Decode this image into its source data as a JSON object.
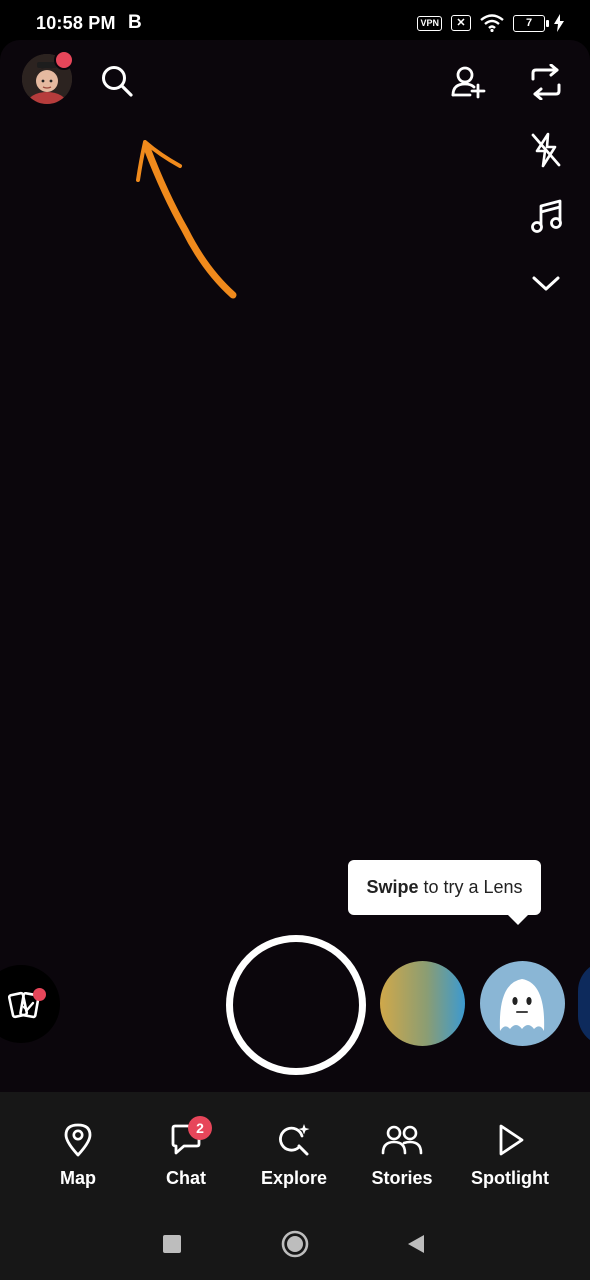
{
  "status_bar": {
    "time": "10:58 PM",
    "app_indicator": "B",
    "vpn_label": "VPN",
    "battery_level": "7"
  },
  "camera": {
    "top_icons": [
      "avatar",
      "search-icon",
      "add-friend-icon",
      "flip-camera-icon",
      "flash-off-icon",
      "music-note-icon",
      "chevron-down-icon"
    ],
    "annotation": "orange-arrow",
    "annotation_color": "#f08a1c"
  },
  "tooltip": {
    "bold": "Swipe",
    "rest": "to try a Lens"
  },
  "nav": {
    "items": [
      {
        "label": "Map",
        "icon": "map-pin-icon"
      },
      {
        "label": "Chat",
        "icon": "chat-icon",
        "badge": "2"
      },
      {
        "label": "Explore",
        "icon": "explore-icon"
      },
      {
        "label": "Stories",
        "icon": "stories-icon"
      },
      {
        "label": "Spotlight",
        "icon": "spotlight-icon"
      }
    ]
  },
  "system_nav": [
    "recents-button",
    "home-button",
    "back-button"
  ],
  "colors": {
    "accent_badge": "#e7465a",
    "camera_bg": "#0b060c",
    "navbar_bg": "#171717"
  }
}
